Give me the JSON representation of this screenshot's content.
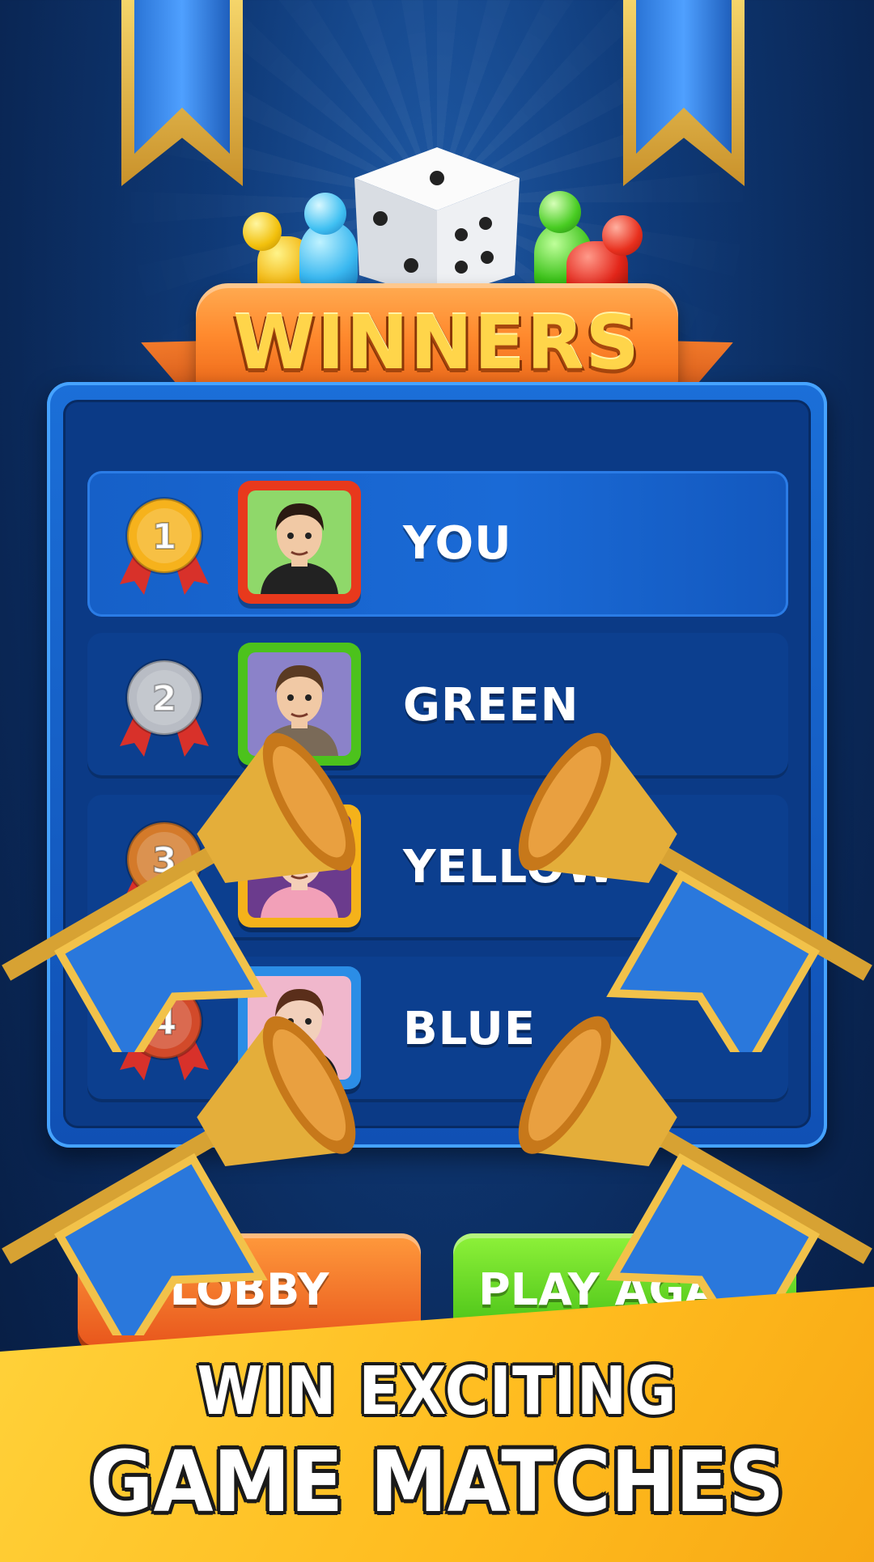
{
  "title": "WINNERS",
  "rankings": [
    {
      "rank": "1",
      "name": "YOU",
      "medal_color": "#f6b21c",
      "frame_color": "#e8391c",
      "bg_color": "#8fd86a",
      "skin": "#f1c9a5",
      "hair": "#2b1a12",
      "shirt": "#222222"
    },
    {
      "rank": "2",
      "name": "GREEN",
      "medal_color": "#b8bcc4",
      "frame_color": "#4cc21c",
      "bg_color": "#8b82c9",
      "skin": "#f1c9a5",
      "hair": "#5a3a22",
      "shirt": "#7a6a58"
    },
    {
      "rank": "3",
      "name": "YELLOW",
      "medal_color": "#d47a2a",
      "frame_color": "#f5b21a",
      "bg_color": "#6b3b8d",
      "skin": "#f4cfb8",
      "hair": "#1c1414",
      "shirt": "#f2a0b8"
    },
    {
      "rank": "4",
      "name": "BLUE",
      "medal_color": "#d24a2a",
      "frame_color": "#2b8de6",
      "bg_color": "#f0b7cc",
      "skin": "#f2d0bb",
      "hair": "#5a2e1a",
      "shirt": "#1e1e1e"
    }
  ],
  "buttons": {
    "lobby": "LOBBY",
    "play_again": "PLAY AGAIN"
  },
  "caption": {
    "line1": "WIN EXCITING",
    "line2": "GAME MATCHES"
  },
  "icons": {
    "dice": "dice-icon",
    "pawns": [
      "yellow-pawn-icon",
      "blue-pawn-icon",
      "green-pawn-icon",
      "red-pawn-icon"
    ],
    "trumpet": "trumpet-icon",
    "medal": "medal-icon"
  }
}
